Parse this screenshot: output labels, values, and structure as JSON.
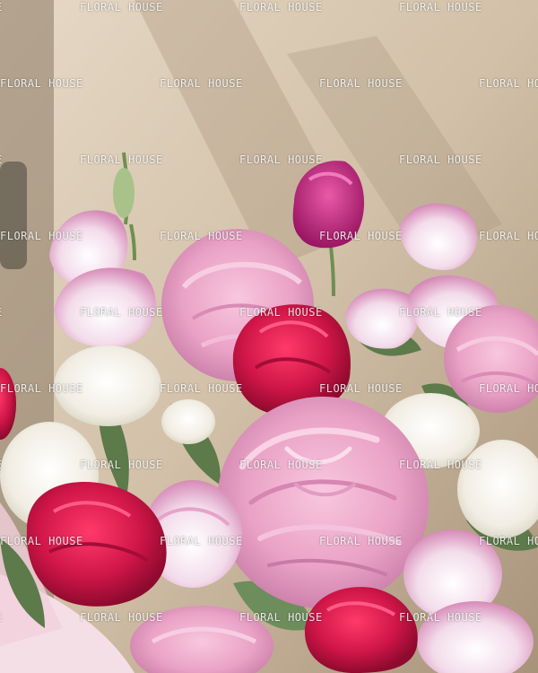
{
  "photo": {
    "subject": "",
    "watermark_text": "FLORAL HOUSE",
    "colors": {
      "wall": "#d9c9b3",
      "shadow": "#9c8a74",
      "peony_pink": "#efaed0",
      "rose_red": "#d01648",
      "lisianthus_white": "#f6f3ee",
      "foliage": "#5d7a4a",
      "wrap": "#f4dfe6"
    }
  }
}
